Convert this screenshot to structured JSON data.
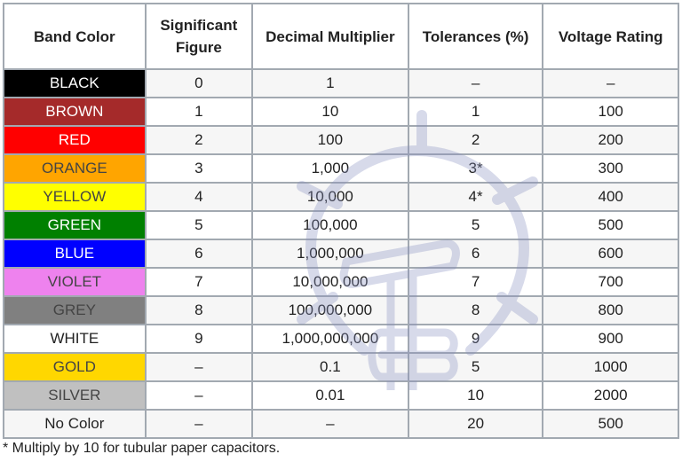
{
  "table": {
    "headers": [
      "Band Color",
      "Significant Figure",
      "Decimal Multiplier",
      "Tolerances (%)",
      "Voltage Rating"
    ],
    "header_lines": {
      "col2_line1": "Significant",
      "col2_line2": "Figure"
    },
    "rows": [
      {
        "band": "BLACK",
        "band_bg": "#000000",
        "band_fg": "#ffffff",
        "figure": "0",
        "multiplier": "1",
        "tolerance": "–",
        "voltage": "–"
      },
      {
        "band": "BROWN",
        "band_bg": "#a52a2a",
        "band_fg": "#ffffff",
        "figure": "1",
        "multiplier": "10",
        "tolerance": "1",
        "voltage": "100"
      },
      {
        "band": "RED",
        "band_bg": "#ff0000",
        "band_fg": "#ffffff",
        "figure": "2",
        "multiplier": "100",
        "tolerance": "2",
        "voltage": "200"
      },
      {
        "band": "ORANGE",
        "band_bg": "#ffa500",
        "band_fg": "#444444",
        "figure": "3",
        "multiplier": "1,000",
        "tolerance": "3*",
        "voltage": "300"
      },
      {
        "band": "YELLOW",
        "band_bg": "#ffff00",
        "band_fg": "#444444",
        "figure": "4",
        "multiplier": "10,000",
        "tolerance": "4*",
        "voltage": "400"
      },
      {
        "band": "GREEN",
        "band_bg": "#008000",
        "band_fg": "#ffffff",
        "figure": "5",
        "multiplier": "100,000",
        "tolerance": "5",
        "voltage": "500"
      },
      {
        "band": "BLUE",
        "band_bg": "#0000ff",
        "band_fg": "#ffffff",
        "figure": "6",
        "multiplier": "1,000,000",
        "tolerance": "6",
        "voltage": "600"
      },
      {
        "band": "VIOLET",
        "band_bg": "#ee82ee",
        "band_fg": "#444444",
        "figure": "7",
        "multiplier": "10,000,000",
        "tolerance": "7",
        "voltage": "700"
      },
      {
        "band": "GREY",
        "band_bg": "#808080",
        "band_fg": "#444444",
        "figure": "8",
        "multiplier": "100,000,000",
        "tolerance": "8",
        "voltage": "800"
      },
      {
        "band": "WHITE",
        "band_bg": "#ffffff",
        "band_fg": "#222222",
        "figure": "9",
        "multiplier": "1,000,000,000",
        "tolerance": "9",
        "voltage": "900"
      },
      {
        "band": "GOLD",
        "band_bg": "#ffd700",
        "band_fg": "#444444",
        "figure": "–",
        "multiplier": "0.1",
        "tolerance": "5",
        "voltage": "1000"
      },
      {
        "band": "SILVER",
        "band_bg": "#c0c0c0",
        "band_fg": "#444444",
        "figure": "–",
        "multiplier": "0.01",
        "tolerance": "10",
        "voltage": "2000"
      },
      {
        "band": "No Color",
        "band_bg": "#f6f6f6",
        "band_fg": "#222222",
        "figure": "–",
        "multiplier": "–",
        "tolerance": "20",
        "voltage": "500"
      }
    ]
  },
  "footnote": "* Multiply by 10 for tubular paper capacitors.",
  "watermark": {
    "icon": "lightbulb-icon",
    "color": "#8890c0"
  }
}
